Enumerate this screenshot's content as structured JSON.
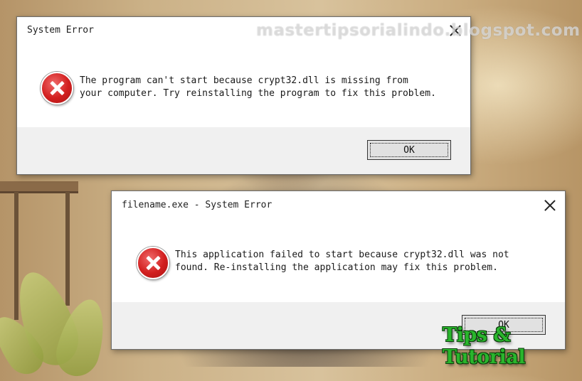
{
  "dialogs": [
    {
      "title": "System Error",
      "message_line1": "The program can't start because crypt32.dll is missing from",
      "message_line2": "your computer. Try reinstalling the program to fix this problem.",
      "ok_label": "OK",
      "icon": "error-icon"
    },
    {
      "title": "filename.exe - System Error",
      "message_line1": "This application failed to start because crypt32.dll was not",
      "message_line2": "found. Re-installing the application may fix this problem.",
      "ok_label": "OK",
      "icon": "error-icon"
    }
  ],
  "overlays": {
    "watermark": "mastertipsorialindo.blogspot.com",
    "logo": "Tips & Tutorial"
  },
  "colors": {
    "dialog_background": "#ffffff",
    "footer_background": "#f0f0f0",
    "error_red": "#d21f1f",
    "logo_green": "#29b52c"
  }
}
